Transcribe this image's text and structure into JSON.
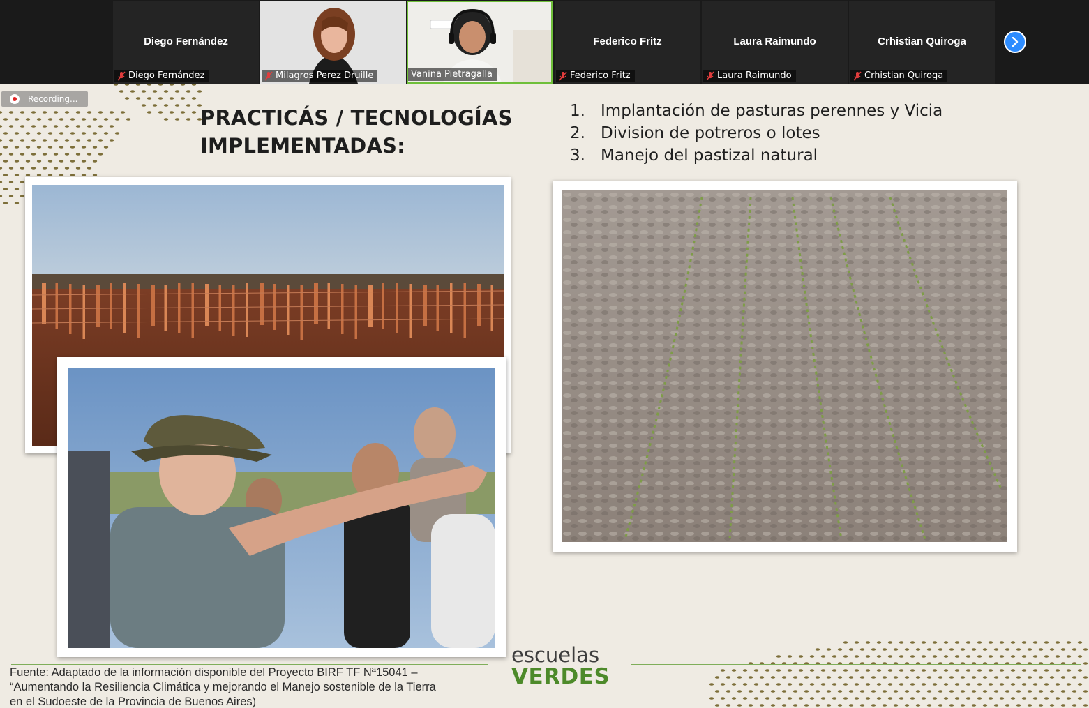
{
  "participants": [
    {
      "name": "Diego Fernández",
      "label": "Diego Fernández",
      "has_video": false
    },
    {
      "name": "Milagros Perez Druille",
      "label": "Milagros Perez Druille",
      "has_video": true
    },
    {
      "name": "Vanina Pietragalla",
      "label": "Vanina Pietragalla",
      "has_video": true
    },
    {
      "name": "Federico Fritz",
      "label": "Federico Fritz",
      "has_video": false
    },
    {
      "name": "Laura Raimundo",
      "label": "Laura Raimundo",
      "has_video": false
    },
    {
      "name": "Crhistian Quiroga",
      "label": "Crhistian Quiroga",
      "has_video": false
    }
  ],
  "recording": {
    "label": "Recording..."
  },
  "slide": {
    "title_line1": "PRACTICÁS / TECNOLOGÍAS",
    "title_line2": "IMPLEMENTADAS:",
    "practices": [
      {
        "num": "1.",
        "text": "Implantación de pasturas perennes y Vicia"
      },
      {
        "num": "2.",
        "text": "Division de potreros o lotes"
      },
      {
        "num": "3.",
        "text": "Manejo del pastizal natural"
      }
    ],
    "source_line1": "Fuente: Adaptado de la información disponible del Proyecto BIRF TF Nª15041 –",
    "source_line2": "“Aumentando la Resiliencia Climática y mejorando el Manejo sostenible de la Tierra",
    "source_line3": "en el Sudoeste de la Provincia de Buenos Aires)",
    "brand_top": "escuelas",
    "brand_bottom": "VERDES"
  },
  "colors": {
    "accent_blue": "#2d8cff",
    "mic_muted": "#e03c3c",
    "brand_green": "#4d8a2a",
    "slide_bg": "#efebe3",
    "active_speaker": "#6fbf3a"
  },
  "icons": [
    "muted-mic-icon",
    "chevron-right-icon",
    "record-icon"
  ]
}
